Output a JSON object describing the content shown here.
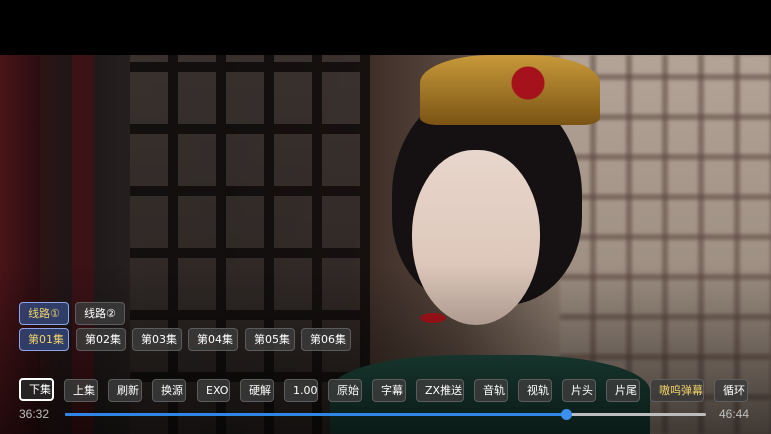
{
  "routes": [
    "线路①",
    "线路②"
  ],
  "selected_route": 0,
  "episodes": [
    "第01集",
    "第02集",
    "第03集",
    "第04集",
    "第05集",
    "第06集"
  ],
  "selected_episode": 0,
  "controls": {
    "next": "下集",
    "prev": "上集",
    "refresh": "刷新",
    "switch_source": "换源",
    "player": "EXO",
    "decoder": "硬解",
    "speed": "1.00",
    "scale": "原始",
    "subtitle": "字幕",
    "cast": "ZX推送",
    "audio_track": "音轨",
    "video_track": "视轨",
    "opening": "片头",
    "ending": "片尾",
    "danmaku": "嗷呜弹幕",
    "loop": "循环"
  },
  "playback": {
    "current_time": "36:32",
    "total_time": "46:44",
    "progress": 0.782
  },
  "colors": {
    "accent": "#2f86e6",
    "selected_text": "#f1d36a",
    "selected_border": "#8fa4e6"
  }
}
